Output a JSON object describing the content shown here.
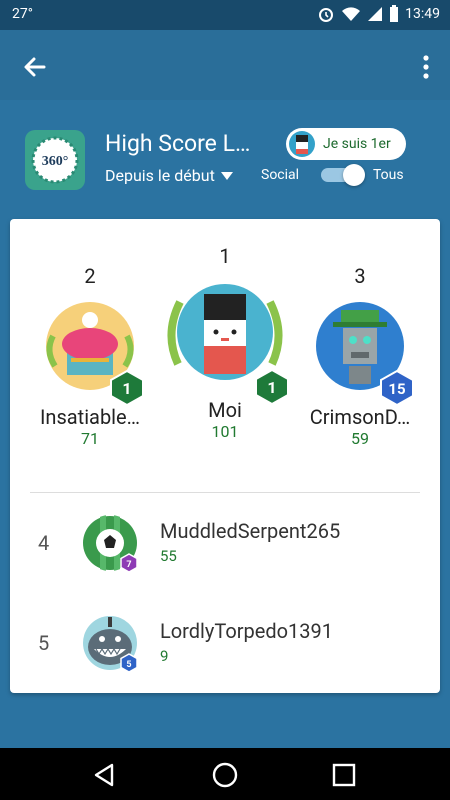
{
  "status": {
    "temperature": "27°",
    "time": "13:49"
  },
  "header": {
    "title": "High Score L…",
    "chip_label": "Je suis 1er",
    "filter_label": "Depuis le début",
    "toggle_left": "Social",
    "toggle_right": "Tous",
    "game_icon_text": "360°"
  },
  "podium": [
    {
      "rank": "2",
      "name": "Insatiable…",
      "score": "71",
      "level": "1"
    },
    {
      "rank": "1",
      "name": "Moi",
      "score": "101",
      "level": "1"
    },
    {
      "rank": "3",
      "name": "CrimsonD…",
      "score": "59",
      "level": "15"
    }
  ],
  "rows": [
    {
      "rank": "4",
      "name": "MuddledSerpent265",
      "score": "55",
      "level": "7"
    },
    {
      "rank": "5",
      "name": "LordlyTorpedo1391",
      "score": "9",
      "level": "5"
    }
  ],
  "colors": {
    "accent": "#217a31",
    "appbar": "#2a6e99",
    "background": "#2b73a1"
  }
}
